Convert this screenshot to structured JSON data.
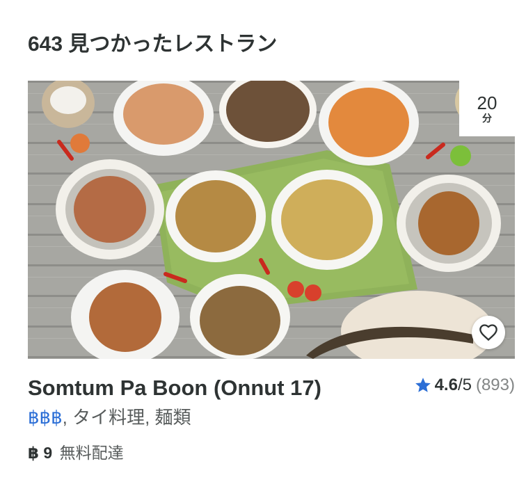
{
  "results": {
    "heading": "643 見つかったレストラン"
  },
  "card": {
    "eta": {
      "value": "20",
      "unit": "分"
    },
    "name": "Somtum Pa Boon (Onnut 17)",
    "rating": {
      "score": "4.6",
      "max": "/5",
      "count": "(893)"
    },
    "price_tier": "฿฿฿",
    "tags": [
      ", タイ料理",
      ", 麺類"
    ],
    "delivery": {
      "fee": "฿ 9",
      "text": "無料配達"
    }
  },
  "colors": {
    "accent_blue": "#2b6ed6",
    "text_dark": "#2e3333",
    "text_muted": "#585c5c"
  },
  "icons": {
    "favorite": "heart-outline-icon",
    "rating": "star-icon"
  }
}
